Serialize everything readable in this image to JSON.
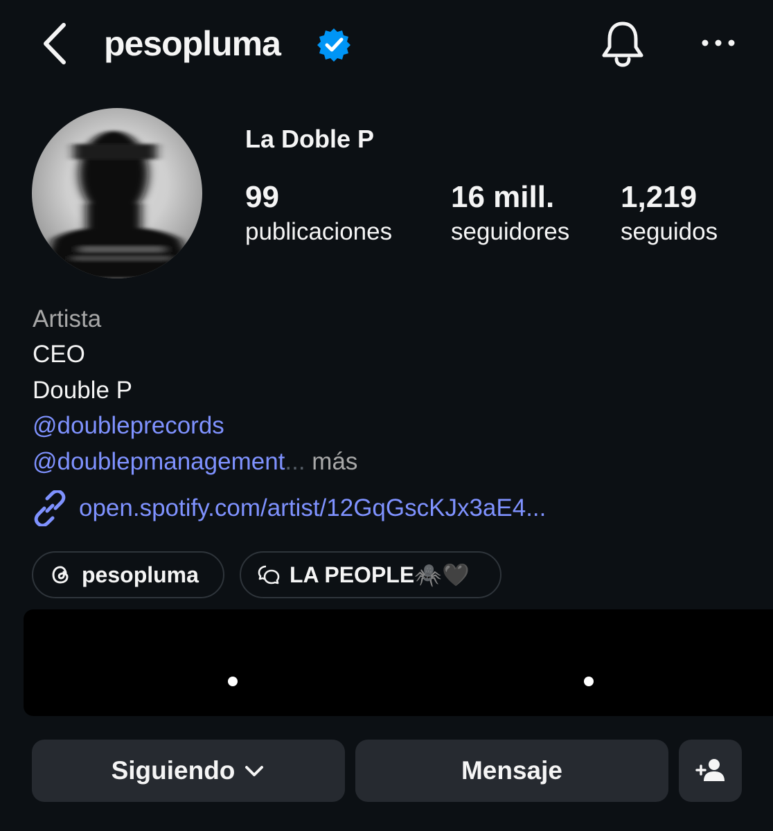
{
  "header": {
    "username": "pesopluma",
    "back_icon": "chevron-left-icon",
    "verified_icon": "verified-badge-icon",
    "bell_icon": "bell-icon",
    "more_icon": "more-horizontal-icon"
  },
  "profile": {
    "display_name": "La Doble P",
    "stats": [
      {
        "value": "99",
        "label": "publicaciones"
      },
      {
        "value": "16 mill.",
        "label": "seguidores"
      },
      {
        "value": "1,219",
        "label": "seguidos"
      }
    ]
  },
  "bio": {
    "category": "Artista",
    "lines": [
      "CEO",
      "Double P"
    ],
    "mentions": [
      "@doubleprecords",
      "@doublepmanagement"
    ],
    "ellipsis": "...",
    "more_label": " más",
    "link_icon": "link-icon",
    "link": "open.spotify.com/artist/12GqGscKJx3aE4..."
  },
  "chips": [
    {
      "icon": "threads-icon",
      "label": "pesopluma"
    },
    {
      "icon": "broadcast-channel-icon",
      "label": "LA PEOPLE🕷️🖤"
    }
  ],
  "actions": {
    "following_label": "Siguiendo",
    "message_label": "Mensaje",
    "add_icon": "add-person-icon"
  },
  "colors": {
    "background": "#0c1014",
    "link": "#7f92ff",
    "verified": "#0095f6",
    "button": "#262a30"
  }
}
